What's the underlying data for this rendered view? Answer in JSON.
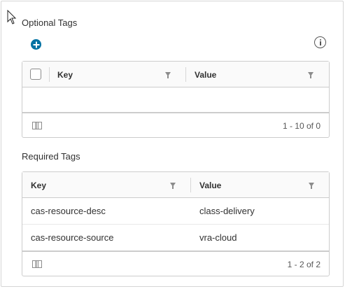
{
  "optional_tags": {
    "title": "Optional Tags",
    "columns": {
      "key": "Key",
      "value": "Value"
    },
    "rows": [],
    "pagination": "1 - 10 of 0"
  },
  "required_tags": {
    "title": "Required Tags",
    "columns": {
      "key": "Key",
      "value": "Value"
    },
    "rows": [
      {
        "key": "cas-resource-desc",
        "value": "class-delivery"
      },
      {
        "key": "cas-resource-source",
        "value": "vra-cloud"
      }
    ],
    "pagination": "1 - 2 of 2"
  },
  "icons": {
    "add": "plus-circle-icon",
    "info": "info-icon",
    "filter": "filter-icon",
    "column_toggle": "column-toggle-icon",
    "cursor": "mouse-pointer-icon"
  },
  "colors": {
    "accent": "#0072a3",
    "border": "#cccccc",
    "header_bg": "#fafafa",
    "text": "#313131"
  }
}
